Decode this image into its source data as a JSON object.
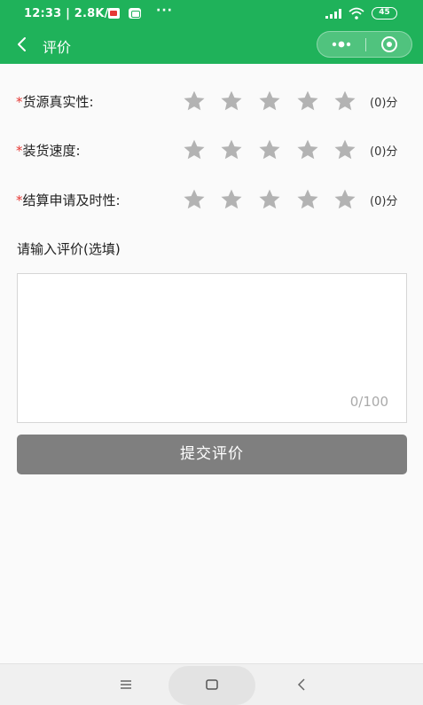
{
  "status_bar": {
    "time": "12:33 | 2.8K/s",
    "dots": "···",
    "battery": "45"
  },
  "nav": {
    "title": "评价",
    "back_icon": "chevron-left-icon",
    "more_icon": "more-dots-icon",
    "close_icon": "target-circle-icon"
  },
  "ratings": [
    {
      "required_mark": "*",
      "label": "货源真实性:",
      "stars_filled": 0,
      "stars_total": 5,
      "score": "(0)分"
    },
    {
      "required_mark": "*",
      "label": "装货速度:",
      "stars_filled": 0,
      "stars_total": 5,
      "score": "(0)分"
    },
    {
      "required_mark": "*",
      "label": "结算申请及时性:",
      "stars_filled": 0,
      "stars_total": 5,
      "score": "(0)分"
    }
  ],
  "comment": {
    "prompt": "请输入评价(选填)",
    "value": "",
    "counter": "0/100"
  },
  "submit_label": "提交评价",
  "colors": {
    "brand_green": "#1fb25a",
    "required_red": "#e53935",
    "star_empty": "#b3b3b3",
    "submit_disabled": "#7f7f7f"
  }
}
